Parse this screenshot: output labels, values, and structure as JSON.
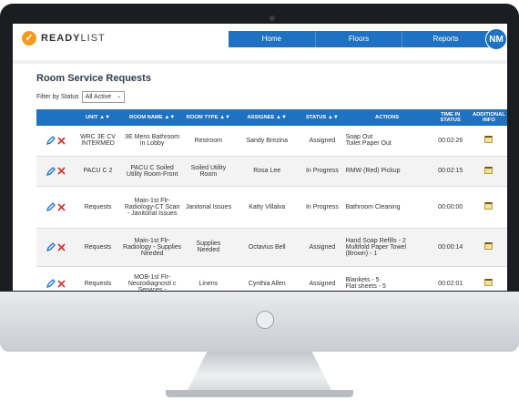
{
  "brand": {
    "name_bold": "READY",
    "name_light": "LIST"
  },
  "nav": [
    {
      "label": "Home"
    },
    {
      "label": "Floors"
    },
    {
      "label": "Reports"
    }
  ],
  "user": {
    "initials": "NM"
  },
  "page": {
    "title": "Room Service Requests"
  },
  "filter": {
    "label": "Filter by Status",
    "value": "All Active"
  },
  "table": {
    "headers": {
      "unit": "UNIT",
      "room_name": "ROOM NAME",
      "room_type": "ROOM TYPE",
      "assignee": "ASSIGNEE",
      "status": "STATUS",
      "actions": "ACTIONS",
      "time_in_status": "TIME IN STATUS",
      "additional_info": "ADDITIONAL INFO"
    },
    "rows": [
      {
        "unit": "WRC 3E CV INTERMED",
        "room_name": "3E Mens Bathroom in Lobby",
        "room_type": "Restroom",
        "assignee": "Sandy Brezina",
        "status": "Assigned",
        "actions": [
          "Soap Out",
          "Toilet Paper Out"
        ],
        "time": "00:02:26"
      },
      {
        "unit": "PACU C 2",
        "room_name": "PACU C Soiled Utility Room-Front",
        "room_type": "Soiled Utility Room",
        "assignee": "Rosa Lee",
        "status": "In Progress",
        "actions": [
          "RMW (Red) Pickup"
        ],
        "time": "00:02:15"
      },
      {
        "unit": "Requests",
        "room_name": "Main-1st Flr-Radiology-CT Scan - Janitorial Issues",
        "room_type": "Janitorial Issues",
        "assignee": "Katty Villalva",
        "status": "In Progress",
        "actions": [
          "Bathroom Cleaning"
        ],
        "time": "00:00:00"
      },
      {
        "unit": "Requests",
        "room_name": "Main-1st Flr-Radiology - Supplies Needed",
        "room_type": "Supplies Needed",
        "assignee": "Octavius Bell",
        "status": "Assigned",
        "actions": [
          "Hand Soap Refills - 2",
          "Multifold Paper Towel (Brown) - 1"
        ],
        "time": "00:00:14"
      },
      {
        "unit": "Requests",
        "room_name": "MOB-1st Flr-Neurodiagnosti c Services -",
        "room_type": "Linens",
        "assignee": "Cynthia Allen",
        "status": "Assigned",
        "actions": [
          "Blankets - 5",
          "Flat sheets - 5"
        ],
        "time": "00:02:01"
      }
    ]
  },
  "icons": {
    "edit": "pencil-icon",
    "delete": "red-x-icon",
    "info": "note-icon",
    "logo": "checkmark-logo-icon"
  },
  "colors": {
    "nav_blue": "#1f72c2",
    "logo_orange": "#f39a21",
    "delete_red": "#d0312d"
  }
}
